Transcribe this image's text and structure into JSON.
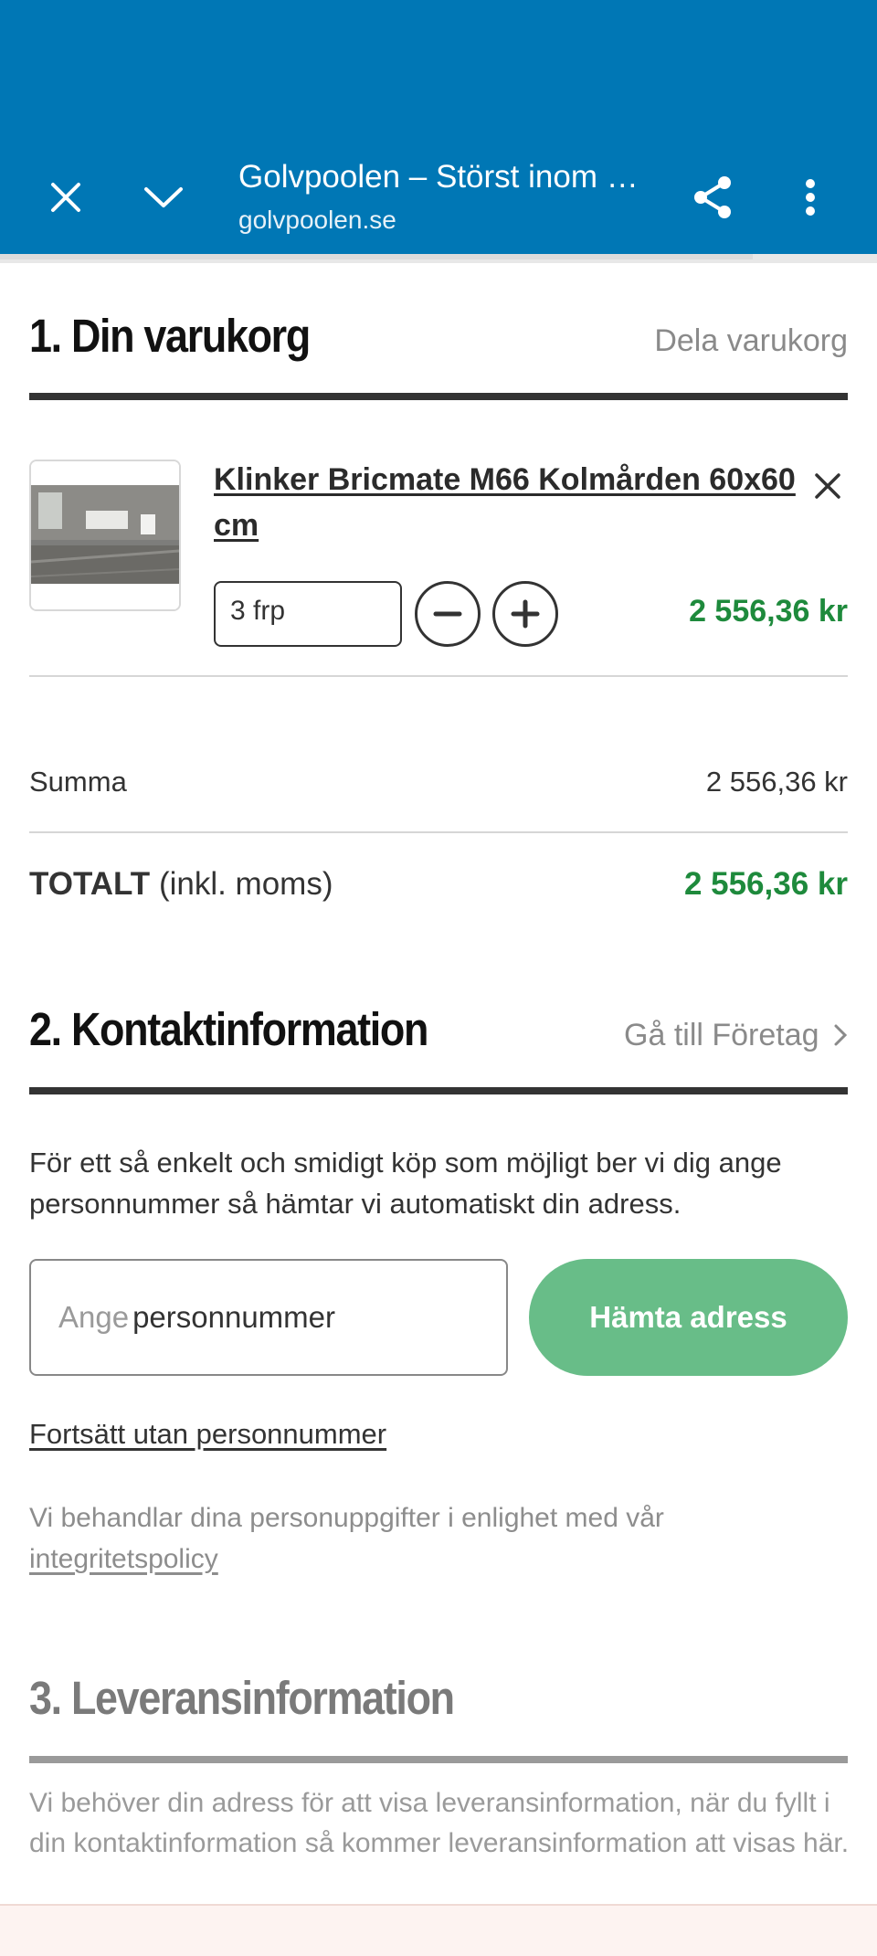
{
  "browser": {
    "title": "Golvpoolen – Störst inom …",
    "url": "golvpoolen.se",
    "color": "#0077b5"
  },
  "cart": {
    "heading": "1. Din varukorg",
    "share_link": "Dela varukorg",
    "item": {
      "name": "Klinker Bricmate M66 Kolmården 60x60 cm",
      "quantity": "3 frp",
      "price": "2 556,36 kr",
      "image": "bathroom-tile-photo"
    },
    "summa_label": "Summa",
    "summa_value": "2 556,36 kr",
    "total_label": "TOTALT",
    "total_suffix": "(inkl. moms)",
    "total_value": "2 556,36 kr",
    "price_color": "#1e8a3c"
  },
  "contact": {
    "heading": "2. Kontaktinformation",
    "company_link": "Gå till Företag",
    "intro": "För ett så enkelt och smidigt köp som möjligt ber vi dig ange personnummer så hämtar vi automatiskt din adress.",
    "input_placeholder": "Ange",
    "input_value": "personnummer",
    "fetch_button": "Hämta adress",
    "button_color": "#68bd88",
    "skip_link": "Fortsätt utan personnummer",
    "privacy_prefix": "Vi behandlar dina personuppgifter i enlighet med vår",
    "privacy_link": "integritetspolicy"
  },
  "delivery": {
    "heading": "3. Leveransinformation",
    "text": "Vi behöver din adress för att visa leveransinformation, när du fyllt i din kontaktinformation så kommer leveransinformation att visas här."
  },
  "icons": [
    "close-icon",
    "chevron-down-icon",
    "share-icon",
    "more-vert-icon",
    "remove-icon",
    "minus-icon",
    "plus-icon",
    "chevron-right-icon"
  ]
}
